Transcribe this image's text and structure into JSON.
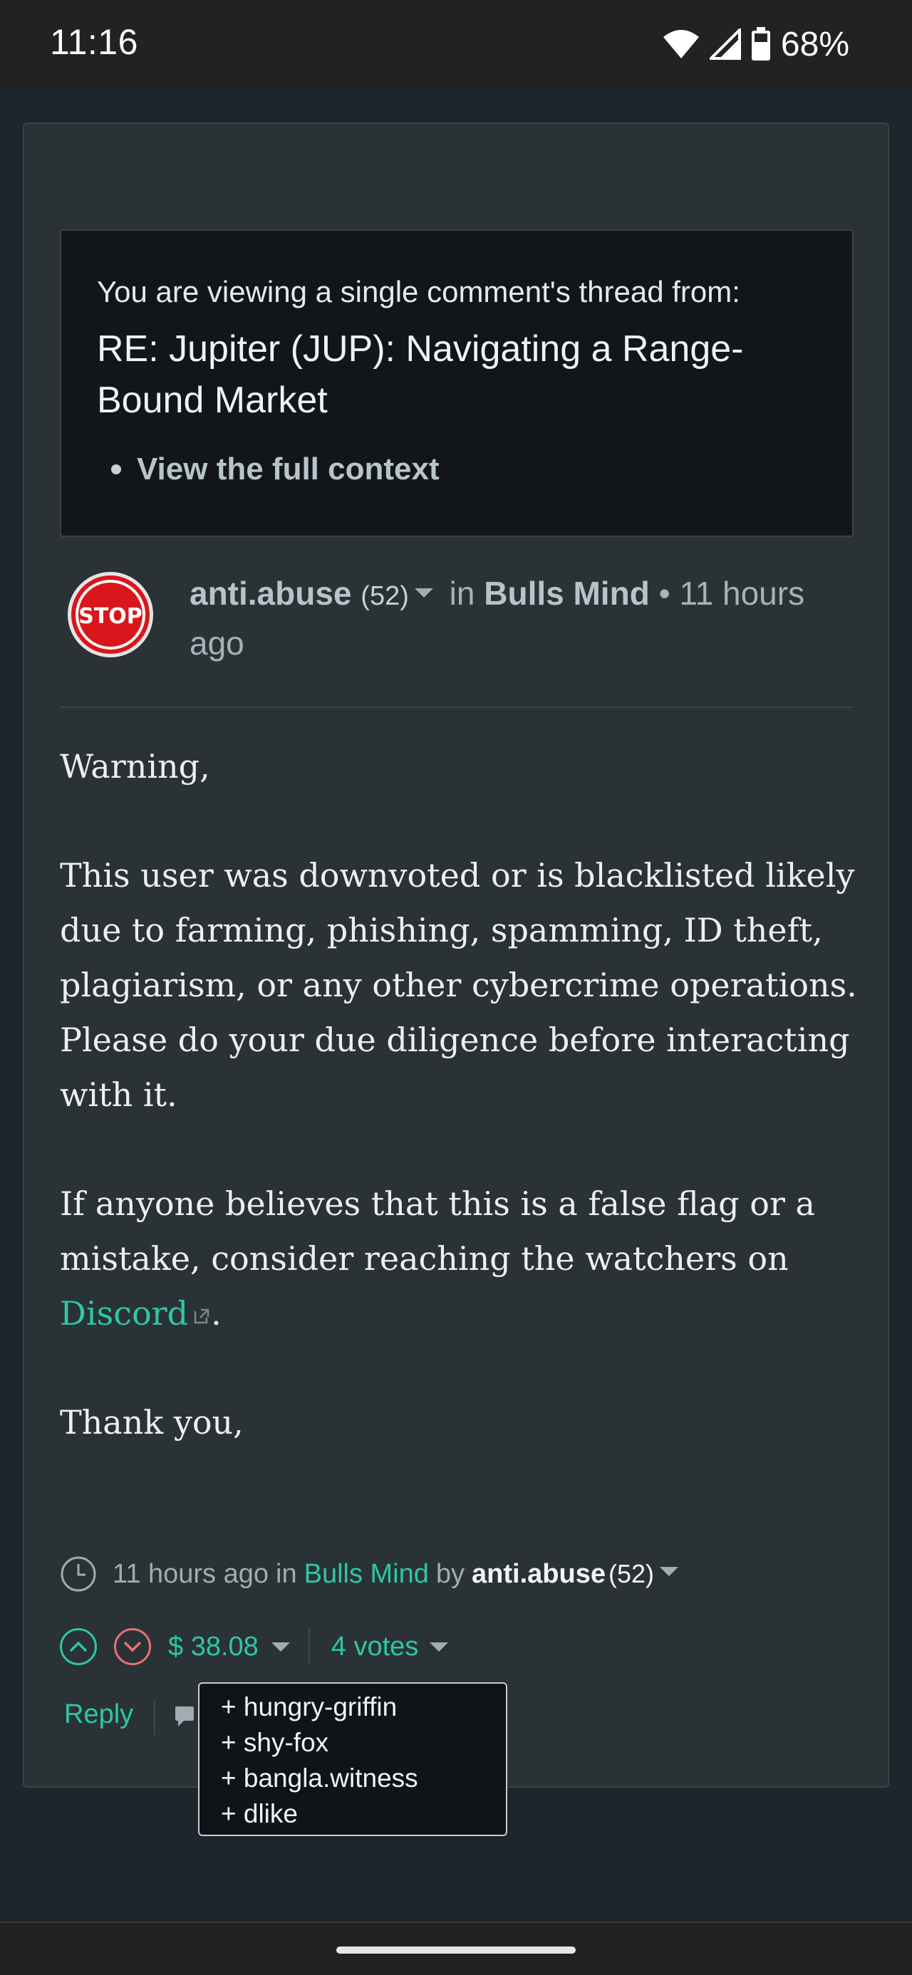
{
  "status_bar": {
    "time": "11:16",
    "battery": "68%",
    "icons": [
      "wifi-icon",
      "signal-icon",
      "battery-icon"
    ]
  },
  "context": {
    "intro": "You are viewing a single comment's thread from:",
    "title": "RE: Jupiter (JUP): Navigating a Range-Bound Market",
    "link": "View the full context"
  },
  "author": {
    "name": "anti.abuse",
    "reputation": "(52)",
    "in_label": "in",
    "community": "Bulls Mind",
    "time": "• 11 hours ago",
    "avatar_text": "STOP"
  },
  "body": {
    "p1": "Warning,",
    "p2": "This user was downvoted or is blacklisted likely due to farming, phishing, spamming, ID theft, plagiarism, or any other cybercrime operations. Please do your due diligence before interacting with it.",
    "p3_before": "If anyone believes that this is a false flag or a mistake, consider reaching the watchers on",
    "p3_link": "Discord",
    "p3_after": ".",
    "p4": "Thank you,"
  },
  "meta": {
    "time": "11 hours ago",
    "in_label": "in",
    "community": "Bulls Mind",
    "by_label": "by",
    "author": "anti.abuse",
    "reputation": "(52)"
  },
  "actions": {
    "payout": "$ 38.08",
    "votes": "4 votes",
    "reply": "Reply"
  },
  "voters": [
    "+ hungry-griffin",
    "+ shy-fox",
    "+ bangla.witness",
    "+ dlike"
  ],
  "colors": {
    "accent": "#2dc7a6",
    "downvote": "#e57373",
    "card_bg": "#2a3236",
    "page_bg": "#1e252c"
  }
}
